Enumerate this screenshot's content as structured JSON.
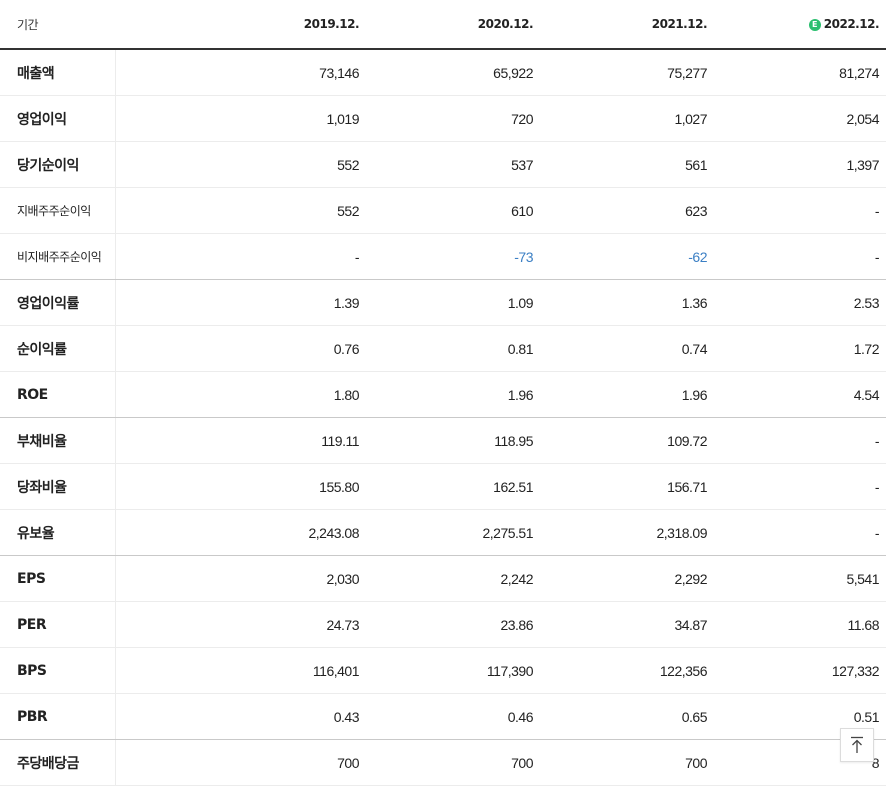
{
  "header": {
    "label": "기간",
    "periods": [
      "2019.12.",
      "2020.12.",
      "2021.12.",
      "2022.12."
    ],
    "estimate_badge": "E"
  },
  "rows": [
    {
      "label": "매출액",
      "values": [
        "73,146",
        "65,922",
        "75,277",
        "81,274"
      ]
    },
    {
      "label": "영업이익",
      "values": [
        "1,019",
        "720",
        "1,027",
        "2,054"
      ]
    },
    {
      "label": "당기순이익",
      "values": [
        "552",
        "537",
        "561",
        "1,397"
      ]
    },
    {
      "label": "지배주주순이익",
      "values": [
        "552",
        "610",
        "623",
        "-"
      ]
    },
    {
      "label": "비지배주주순이익",
      "values": [
        "-",
        "-73",
        "-62",
        "-"
      ]
    },
    {
      "label": "영업이익률",
      "values": [
        "1.39",
        "1.09",
        "1.36",
        "2.53"
      ]
    },
    {
      "label": "순이익률",
      "values": [
        "0.76",
        "0.81",
        "0.74",
        "1.72"
      ]
    },
    {
      "label": "ROE",
      "values": [
        "1.80",
        "1.96",
        "1.96",
        "4.54"
      ]
    },
    {
      "label": "부채비율",
      "values": [
        "119.11",
        "118.95",
        "109.72",
        "-"
      ]
    },
    {
      "label": "당좌비율",
      "values": [
        "155.80",
        "162.51",
        "156.71",
        "-"
      ]
    },
    {
      "label": "유보율",
      "values": [
        "2,243.08",
        "2,275.51",
        "2,318.09",
        "-"
      ]
    },
    {
      "label": "EPS",
      "values": [
        "2,030",
        "2,242",
        "2,292",
        "5,541"
      ]
    },
    {
      "label": "PER",
      "values": [
        "24.73",
        "23.86",
        "34.87",
        "11.68"
      ]
    },
    {
      "label": "BPS",
      "values": [
        "116,401",
        "117,390",
        "122,356",
        "127,332"
      ]
    },
    {
      "label": "PBR",
      "values": [
        "0.43",
        "0.46",
        "0.65",
        "0.51"
      ]
    },
    {
      "label": "주당배당금",
      "values": [
        "700",
        "700",
        "700",
        "8"
      ]
    }
  ],
  "colors": {
    "negative_value": "#3b7fc4",
    "estimate_badge": "#2bbf6f",
    "header_border": "#333333"
  },
  "scroll_top_icon": "arrow-up-to-top-icon"
}
